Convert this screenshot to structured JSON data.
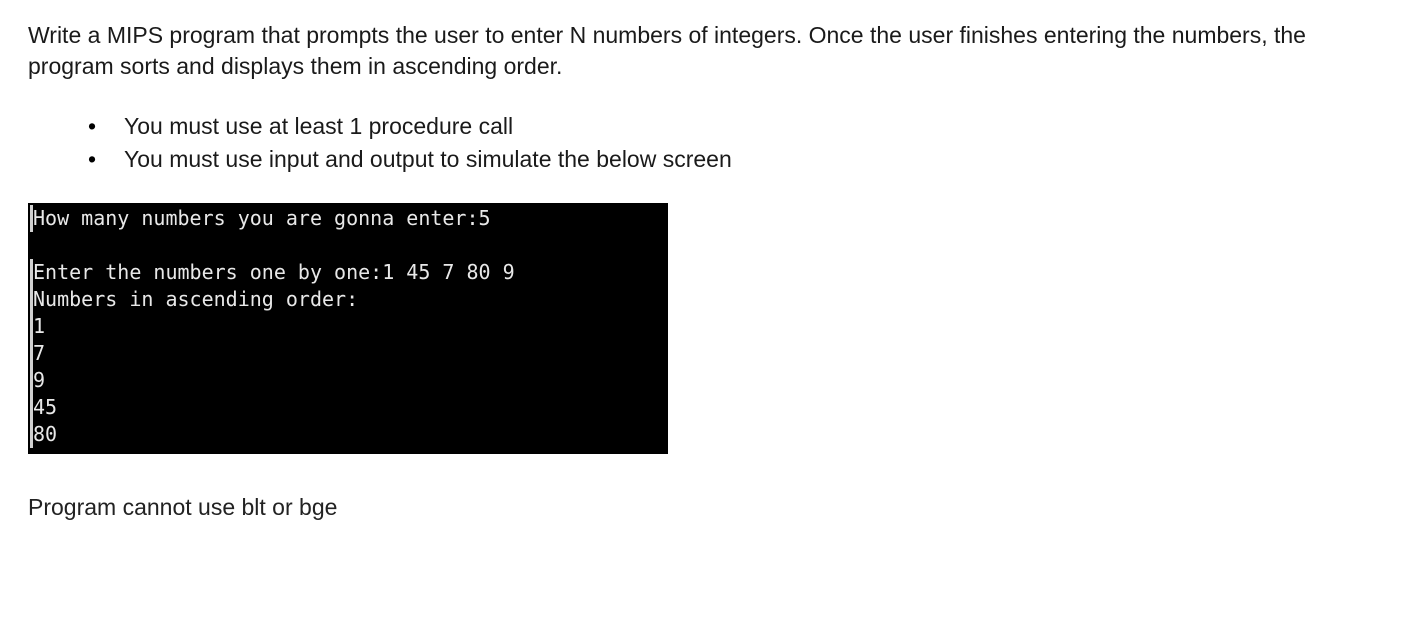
{
  "intro": "Write a MIPS program that prompts the user to enter N numbers of integers. Once the user finishes entering the numbers, the program sorts and displays them in ascending order.",
  "requirements": [
    "You must use at least 1 procedure call",
    "You must use input and output to simulate the below screen"
  ],
  "terminal": {
    "line1": "How many numbers you are gonna enter:5",
    "line2": "Enter the numbers one by one:1 45 7 80 9",
    "line3": "Numbers in ascending order:",
    "out1": "1",
    "out2": "7",
    "out3": "9",
    "out4": "45",
    "out5": "80"
  },
  "constraint": "Program cannot use blt or bge"
}
